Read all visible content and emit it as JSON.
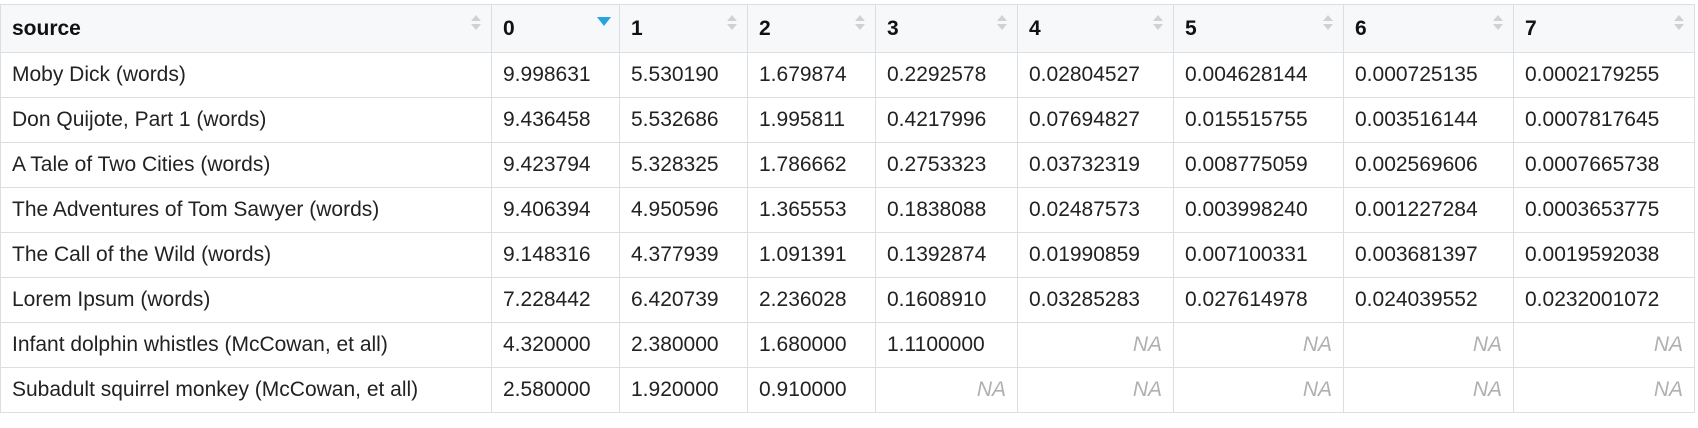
{
  "table": {
    "columns": [
      "source",
      "0",
      "1",
      "2",
      "3",
      "4",
      "5",
      "6",
      "7"
    ],
    "sorted_column_index": 1,
    "sort_direction": "descending",
    "na_label": "NA",
    "rows": [
      [
        "Moby Dick (words)",
        "9.998631",
        "5.530190",
        "1.679874",
        "0.2292578",
        "0.02804527",
        "0.004628144",
        "0.000725135",
        "0.0002179255"
      ],
      [
        "Don Quijote, Part 1 (words)",
        "9.436458",
        "5.532686",
        "1.995811",
        "0.4217996",
        "0.07694827",
        "0.015515755",
        "0.003516144",
        "0.0007817645"
      ],
      [
        "A Tale of Two Cities (words)",
        "9.423794",
        "5.328325",
        "1.786662",
        "0.2753323",
        "0.03732319",
        "0.008775059",
        "0.002569606",
        "0.0007665738"
      ],
      [
        "The Adventures of Tom Sawyer (words)",
        "9.406394",
        "4.950596",
        "1.365553",
        "0.1838088",
        "0.02487573",
        "0.003998240",
        "0.001227284",
        "0.0003653775"
      ],
      [
        "The Call of the Wild (words)",
        "9.148316",
        "4.377939",
        "1.091391",
        "0.1392874",
        "0.01990859",
        "0.007100331",
        "0.003681397",
        "0.0019592038"
      ],
      [
        "Lorem Ipsum (words)",
        "7.228442",
        "6.420739",
        "2.236028",
        "0.1608910",
        "0.03285283",
        "0.027614978",
        "0.024039552",
        "0.0232001072"
      ],
      [
        "Infant dolphin whistles (McCowan, et all)",
        "4.320000",
        "2.380000",
        "1.680000",
        "1.1100000",
        "NA",
        "NA",
        "NA",
        "NA"
      ],
      [
        "Subadult squirrel monkey (McCowan, et all)",
        "2.580000",
        "1.920000",
        "0.910000",
        "NA",
        "NA",
        "NA",
        "NA",
        "NA"
      ]
    ]
  },
  "colors": {
    "sort_active": "#29a3dd",
    "na_text": "#b0b0b0",
    "border": "#dcdfe2"
  }
}
